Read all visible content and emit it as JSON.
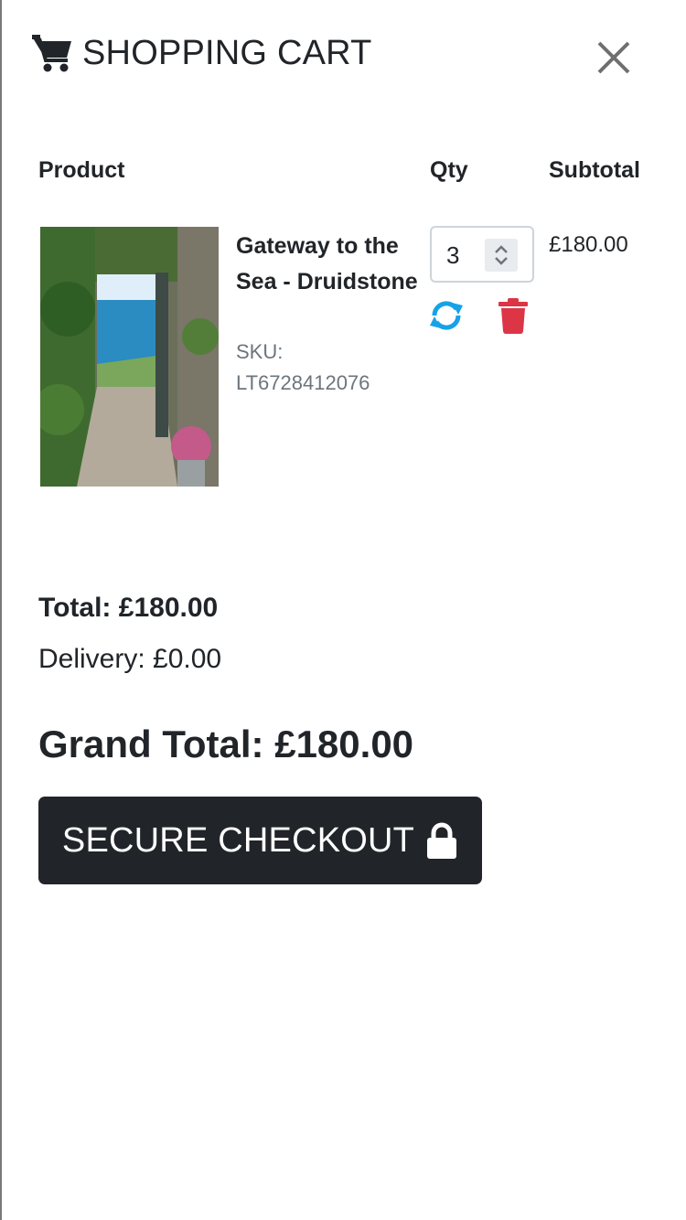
{
  "header": {
    "title": "SHOPPING CART",
    "cart_icon": "shopping-cart-icon",
    "close_icon": "close-icon"
  },
  "table": {
    "columns": [
      "Product",
      "Qty",
      "Subtotal"
    ]
  },
  "items": [
    {
      "name": "Gateway to the Sea - Druidstone",
      "sku_label": "SKU:",
      "sku": "LT6728412076",
      "qty": "3",
      "subtotal": "£180.00",
      "update_icon": "refresh-icon",
      "remove_icon": "trash-icon"
    }
  ],
  "summary": {
    "total": "Total: £180.00",
    "delivery": "Delivery: £0.00",
    "grand_total": "Grand Total: £180.00"
  },
  "checkout": {
    "label": "SECURE CHECKOUT",
    "icon": "lock-icon"
  },
  "colors": {
    "primary_dark": "#212529",
    "refresh": "#17a2e8",
    "remove": "#dc3545",
    "muted": "#6c757d"
  }
}
